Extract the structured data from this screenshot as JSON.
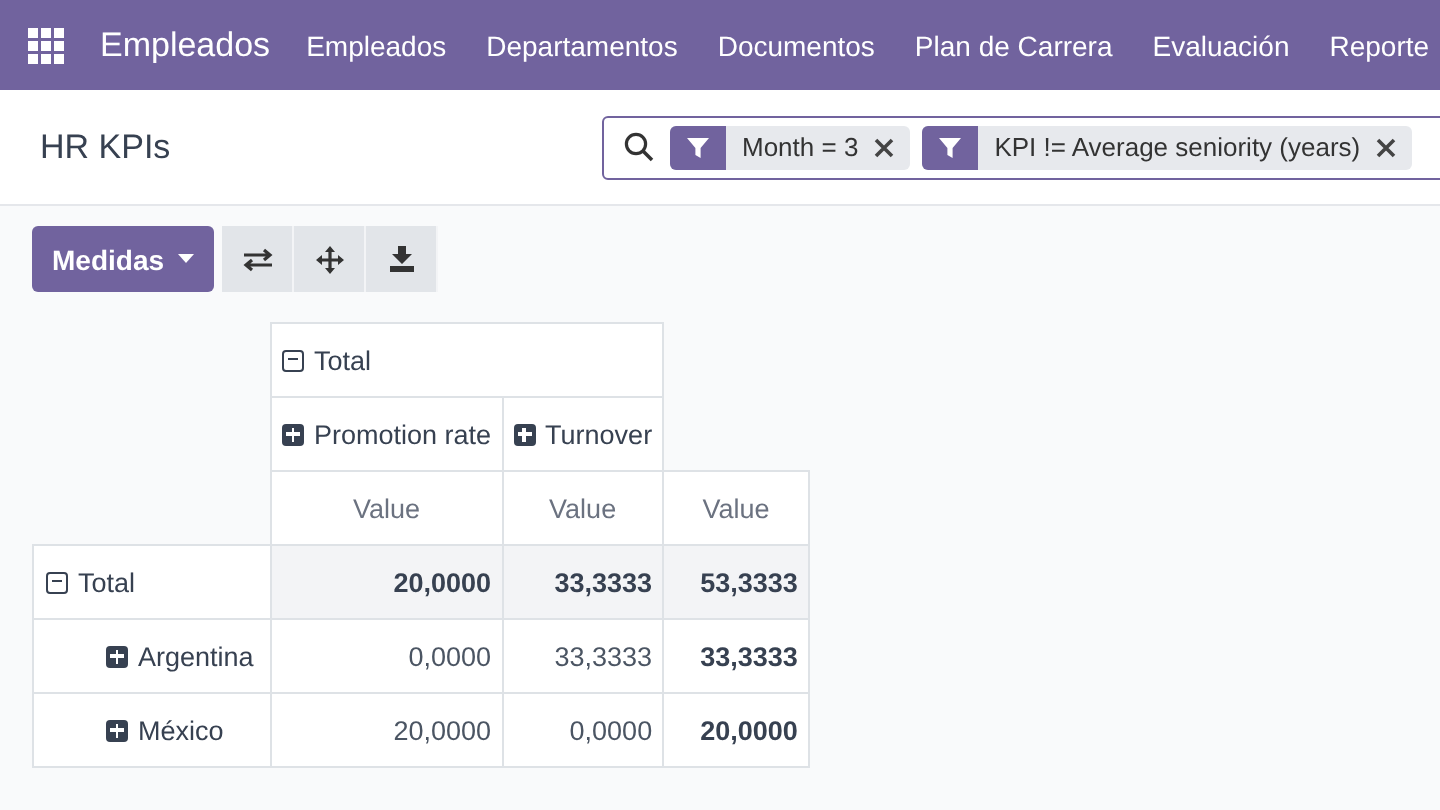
{
  "navbar": {
    "app_name": "Empleados",
    "menu": [
      "Empleados",
      "Departamentos",
      "Documentos",
      "Plan de Carrera",
      "Evaluación",
      "Reporte"
    ]
  },
  "breadcrumb": "HR KPIs",
  "search": {
    "facets": [
      {
        "label": "Month = 3"
      },
      {
        "label": "KPI != Average seniority (years)"
      }
    ]
  },
  "toolbar": {
    "measures_button": "Medidas"
  },
  "pivot": {
    "col_header": {
      "label": "Total",
      "expanded": true,
      "children": [
        {
          "label": "Promotion rate",
          "expanded": false
        },
        {
          "label": "Turnover",
          "expanded": false
        }
      ]
    },
    "measures": [
      "Value",
      "Value",
      "Value"
    ],
    "rows": [
      {
        "label": "Total",
        "expanded": true,
        "values": [
          "20,0000",
          "33,3333",
          "53,3333"
        ],
        "children": [
          {
            "label": "Argentina",
            "expanded": false,
            "values": [
              "0,0000",
              "33,3333",
              "33,3333"
            ]
          },
          {
            "label": "México",
            "expanded": false,
            "values": [
              "20,0000",
              "0,0000",
              "20,0000"
            ]
          }
        ]
      }
    ]
  }
}
